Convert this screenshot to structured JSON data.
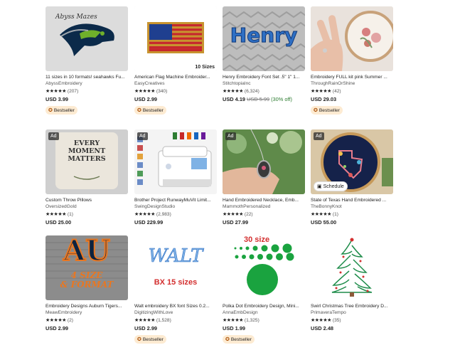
{
  "listings": [
    {
      "title": "11 sizes in 10 formats! seahawks Fu...",
      "shop": "AbyssEmbroidery",
      "rating": "(207)",
      "price": "USD 3.99",
      "bestseller": "Bestseller",
      "overlay": "Abyss Mazes"
    },
    {
      "title": "American Flag Machine Embroider...",
      "shop": "EasyCreatives",
      "rating": "(340)",
      "price": "USD 2.99",
      "bestseller": "Bestseller",
      "overlay": "10 Sizes"
    },
    {
      "title": "Henry Embroidery Font Set .5\" 1\" 1...",
      "shop": "StitchtopiaInc",
      "rating": "(6,324)",
      "price": "USD 4.19",
      "orig": "USD 5.99",
      "discount": "(30% off)",
      "overlay": "Henry"
    },
    {
      "title": "Embroidery FULL kit pink Summer ...",
      "shop": "ThroughRainOrShine",
      "rating": "(42)",
      "price": "USD 29.03",
      "bestseller": "Bestseller"
    },
    {
      "title": "Custom Throw Pillows",
      "shop": "OversizedGold",
      "rating": "(1)",
      "price": "USD 25.00",
      "ad": "Ad",
      "overlay_lines": [
        "EVERY",
        "MOMENT",
        "MATTERS"
      ]
    },
    {
      "title": "Brother Project RunwayMuVit Limit...",
      "shop": "SwingDesignStudio",
      "rating": "(2,983)",
      "price": "USD 229.99",
      "ad": "Ad"
    },
    {
      "title": "Hand Embroidered Necklace, Emb...",
      "shop": "MammothPersonalized",
      "rating": "(22)",
      "price": "USD 27.99",
      "ad": "Ad"
    },
    {
      "title": "State of Texas Hand Embroidered ...",
      "shop": "TheBonnyKnot",
      "rating": "(1)",
      "price": "USD 55.00",
      "ad": "Ad",
      "schedule": "Schedule"
    },
    {
      "title": "Embroidery Designs Auburn Tigers...",
      "shop": "MeawEmbroidery",
      "rating": "(2)",
      "price": "USD 2.99",
      "overlay_lines": [
        "AU",
        "4 SIZE",
        "& FORMAT"
      ]
    },
    {
      "title": "Walt embroidery BX font Sizes 0.2...",
      "shop": "DigitizingWithLove",
      "rating": "(1,528)",
      "price": "USD 2.99",
      "bestseller": "Bestseller",
      "overlay_lines": [
        "WALT",
        "BX 15 sizes"
      ]
    },
    {
      "title": "Polka Dot Embroidery Design, Mini...",
      "shop": "AnnaEmbDesign",
      "rating": "(1,325)",
      "price": "USD 1.99",
      "bestseller": "Bestseller",
      "overlay": "30 size"
    },
    {
      "title": "Swirl Christmas Tree Embroidery D...",
      "shop": "PrimaveraTempo",
      "rating": "(35)",
      "price": "USD 2.48"
    }
  ],
  "stars": "★★★★★",
  "colors": {
    "accent": "#a94c00",
    "badge_bg": "#fdebd2",
    "green": "#1aa33f"
  }
}
